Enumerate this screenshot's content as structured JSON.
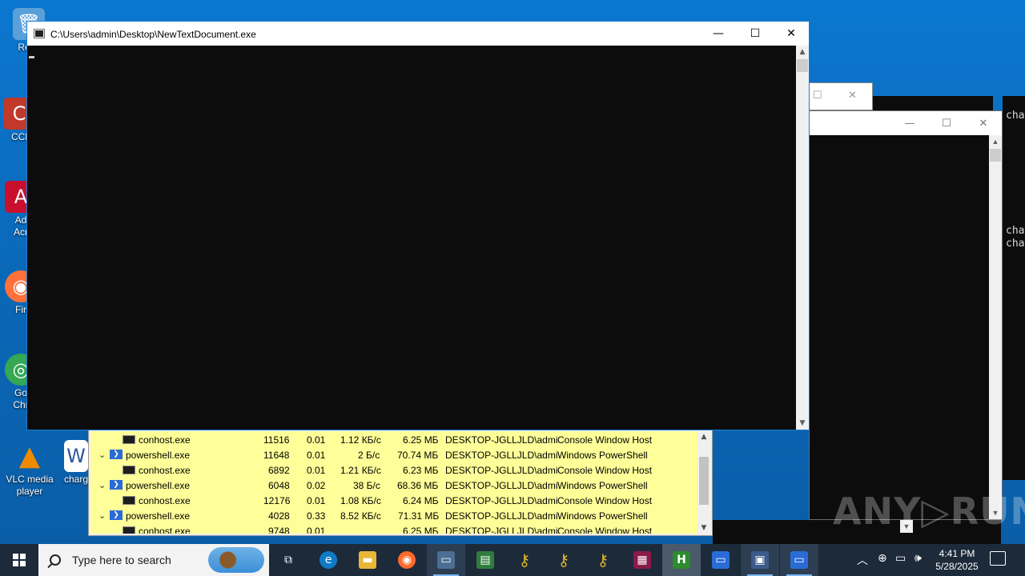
{
  "desktop": {
    "icons": [
      {
        "label": "Recy",
        "glyph": "🗑",
        "color": "#5aa0d8"
      },
      {
        "label": "CCl",
        "glyph": "C",
        "color": "#c0392b"
      },
      {
        "label": "Ad\nAcr",
        "glyph": "A",
        "color": "#c8102e"
      },
      {
        "label": "Fir",
        "glyph": "◉",
        "color": "#ff7139"
      },
      {
        "label": "Go\nChr",
        "glyph": "◎",
        "color": "#34a853"
      },
      {
        "label": "VLC media player",
        "glyph": "▲",
        "color": "#f08a00"
      },
      {
        "label": "charg",
        "glyph": "W",
        "color": "#2b579a"
      }
    ]
  },
  "main_window": {
    "title": "C:\\Users\\admin\\Desktop\\NewTextDocument.exe",
    "minimize_glyph": "—",
    "maximize_glyph": "☐",
    "close_glyph": "✕"
  },
  "back_window": {
    "minimize_glyph": "—",
    "maximize_glyph": "☐",
    "close_glyph": "✕"
  },
  "right_console_text": [
    "cha",
    "cha",
    "cha"
  ],
  "process_list": {
    "rows": [
      {
        "expand": "",
        "icon": "cmd",
        "name": "conhost.exe",
        "pid": "11516",
        "cpu": "0.01",
        "io": "1.12 КБ/с",
        "mem": "6.25 МБ",
        "user": "DESKTOP-JGLLJLD\\admi",
        "desc": "Console Window Host"
      },
      {
        "expand": "⌄",
        "icon": "ps",
        "name": "powershell.exe",
        "pid": "11648",
        "cpu": "0.01",
        "io": "2 Б/с",
        "mem": "70.74 МБ",
        "user": "DESKTOP-JGLLJLD\\admi",
        "desc": "Windows PowerShell"
      },
      {
        "expand": "",
        "icon": "cmd",
        "name": "conhost.exe",
        "pid": "6892",
        "cpu": "0.01",
        "io": "1.21 КБ/с",
        "mem": "6.23 МБ",
        "user": "DESKTOP-JGLLJLD\\admi",
        "desc": "Console Window Host"
      },
      {
        "expand": "⌄",
        "icon": "ps",
        "name": "powershell.exe",
        "pid": "6048",
        "cpu": "0.02",
        "io": "38 Б/с",
        "mem": "68.36 МБ",
        "user": "DESKTOP-JGLLJLD\\admi",
        "desc": "Windows PowerShell"
      },
      {
        "expand": "",
        "icon": "cmd",
        "name": "conhost.exe",
        "pid": "12176",
        "cpu": "0.01",
        "io": "1.08 КБ/с",
        "mem": "6.24 МБ",
        "user": "DESKTOP-JGLLJLD\\admi",
        "desc": "Console Window Host"
      },
      {
        "expand": "⌄",
        "icon": "ps",
        "name": "powershell.exe",
        "pid": "4028",
        "cpu": "0.33",
        "io": "8.52 КБ/с",
        "mem": "71.31 МБ",
        "user": "DESKTOP-JGLLJLD\\admi",
        "desc": "Windows PowerShell"
      },
      {
        "expand": "",
        "icon": "cmd",
        "name": "conhost.exe",
        "pid": "9748",
        "cpu": "0.01",
        "io": "",
        "mem": "6.25 МБ",
        "user": "DESKTOP-JGLLJLD\\admi",
        "desc": "Console Window Host"
      }
    ]
  },
  "watermark": "ANY▷RUN",
  "taskbar": {
    "search_placeholder": "Type here to search",
    "apps": [
      {
        "name": "task-view",
        "glyph": "⧉",
        "color": "transparent"
      },
      {
        "name": "edge",
        "glyph": "e",
        "color": "#0f7bc7"
      },
      {
        "name": "file-explorer",
        "glyph": "▬",
        "color": "#e8b73a"
      },
      {
        "name": "firefox",
        "glyph": "◉",
        "color": "#ff6a2b"
      },
      {
        "name": "app-window-1",
        "glyph": "▭",
        "color": "#4b6f93"
      },
      {
        "name": "app-window-2",
        "glyph": "▤",
        "color": "#2f7d3c"
      },
      {
        "name": "key-app-1",
        "glyph": "⚷",
        "color": "#c9a227"
      },
      {
        "name": "key-app-2",
        "glyph": "⚷",
        "color": "#c9a227"
      },
      {
        "name": "key-app-3",
        "glyph": "⚷",
        "color": "#c9a227"
      },
      {
        "name": "winrar",
        "glyph": "▦",
        "color": "#8b1a4a"
      },
      {
        "name": "hex-app",
        "glyph": "H",
        "color": "#2e8b2e"
      },
      {
        "name": "console-app-1",
        "glyph": "▭",
        "color": "#2a6cd6"
      },
      {
        "name": "console-app-2",
        "glyph": "▣",
        "color": "#3c5a8a"
      },
      {
        "name": "console-app-3",
        "glyph": "▭",
        "color": "#2a6cd6"
      }
    ],
    "tray": {
      "chevron": "︿",
      "icon1": "⊕",
      "network": "▭",
      "volume": "🕪"
    },
    "clock": {
      "time": "4:41 PM",
      "date": "5/28/2025"
    }
  }
}
